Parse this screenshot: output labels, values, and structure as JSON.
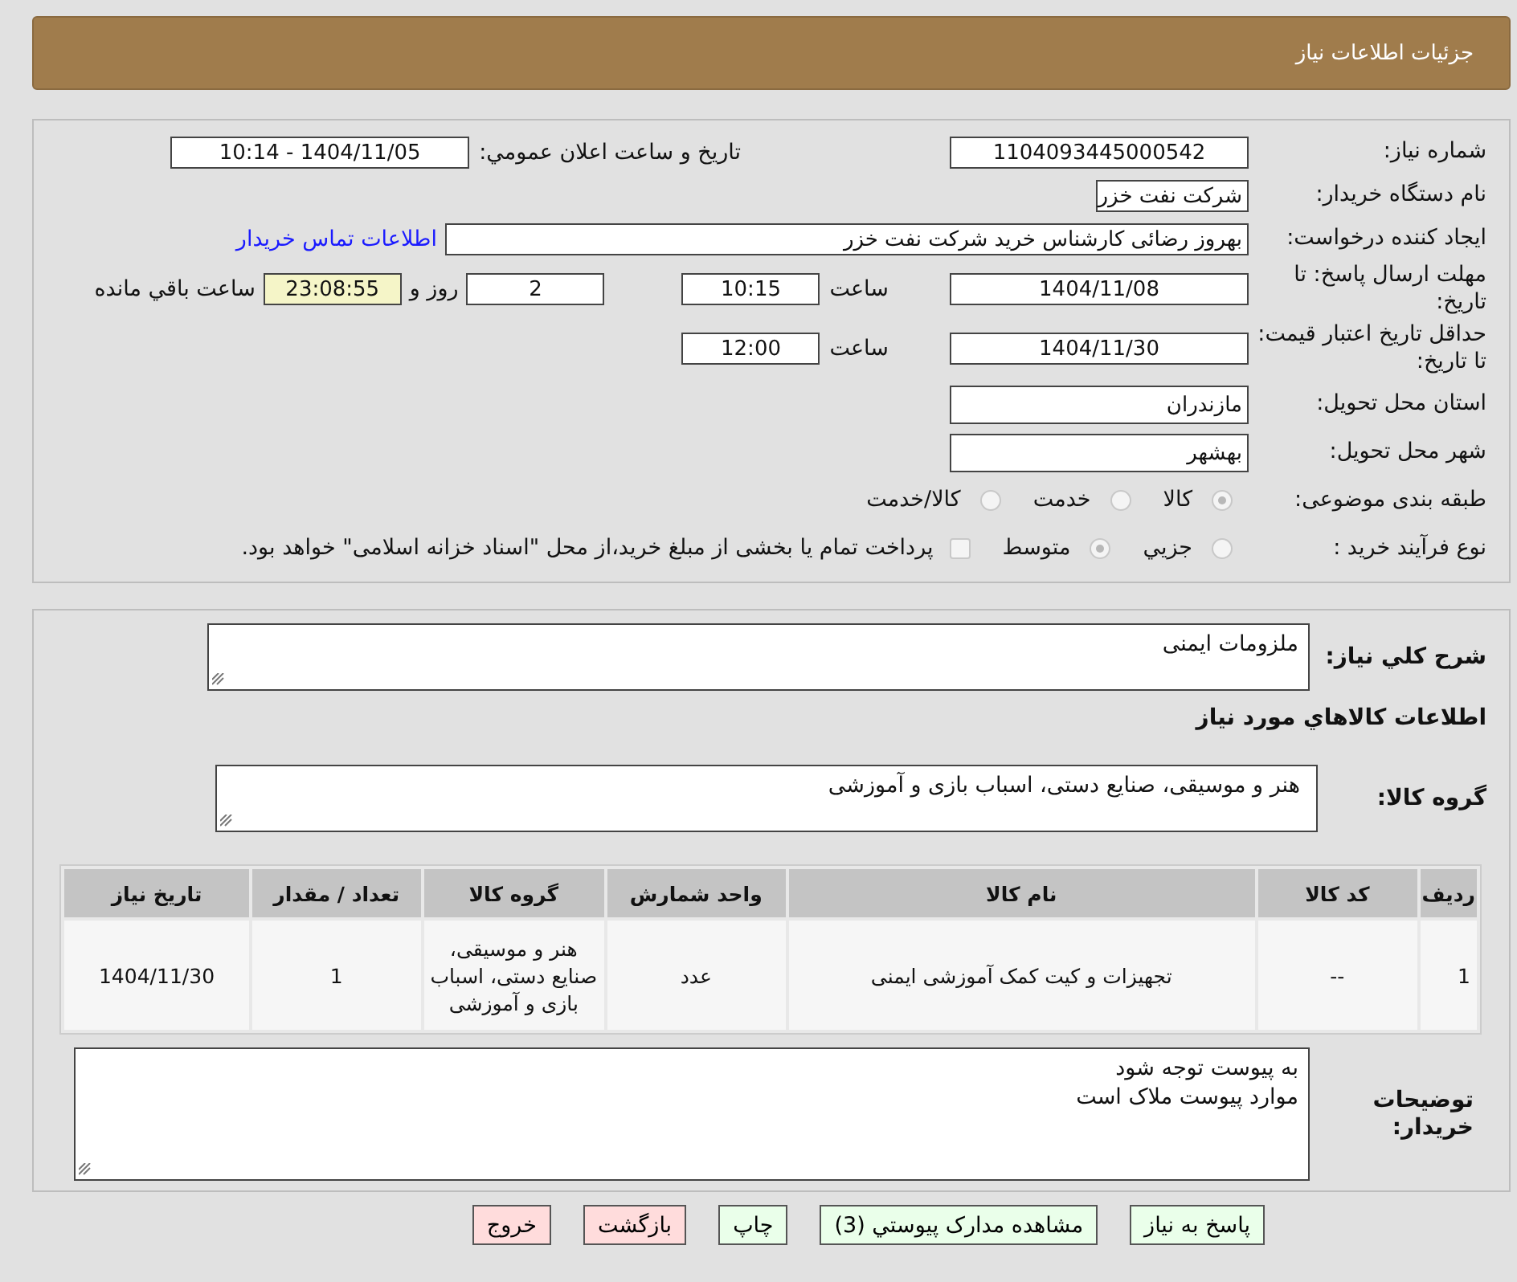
{
  "header": {
    "title": "جزئیات اطلاعات نیاز"
  },
  "details": {
    "need_number": {
      "label": "شماره نیاز:",
      "value": "1104093445000542"
    },
    "announce": {
      "label": "تاریخ و ساعت اعلان عمومي:",
      "value": "1404/11/05 - 10:14"
    },
    "buyer": {
      "label": "نام دستگاه خریدار:",
      "value": "شرکت نفت خزر"
    },
    "creator": {
      "label": "ایجاد کننده درخواست:",
      "value": "بهروز رضائی کارشناس خرید شرکت نفت خزر",
      "link": "اطلاعات تماس خریدار"
    },
    "deadline": {
      "label": "مهلت ارسال پاسخ: تا تاریخ:",
      "date": "1404/11/08",
      "time_label": "ساعت",
      "time": "10:15",
      "days": "2",
      "days_label": "روز و",
      "remaining": "23:08:55",
      "remaining_label": "ساعت باقي مانده"
    },
    "validity": {
      "label": "حداقل تاریخ اعتبار قیمت: تا تاریخ:",
      "date": "1404/11/30",
      "time_label": "ساعت",
      "time": "12:00"
    },
    "province": {
      "label": "استان محل تحویل:",
      "value": "مازندران"
    },
    "city": {
      "label": "شهر محل تحویل:",
      "value": "بهشهر"
    },
    "category": {
      "label": "طبقه بندی موضوعی:",
      "options": [
        {
          "label": "کالا",
          "selected": true
        },
        {
          "label": "خدمت",
          "selected": false
        },
        {
          "label": "کالا/خدمت",
          "selected": false
        }
      ]
    },
    "process": {
      "label": "نوع فرآیند خرید :",
      "options": [
        {
          "label": "جزيي",
          "selected": false
        },
        {
          "label": "متوسط",
          "selected": true
        }
      ],
      "treasury": {
        "checked": false,
        "label": "پرداخت تمام یا بخشی از مبلغ خرید،از محل \"اسناد خزانه اسلامی\" خواهد بود."
      }
    }
  },
  "description": {
    "label": "شرح كلي نياز:",
    "value": "ملزومات ایمنی"
  },
  "goods_heading": "اطلاعات كالاهاي مورد نياز",
  "goods_group": {
    "label": "گروه کالا:",
    "value": "هنر و موسیقی، صنایع دستی، اسباب بازی و آموزشی"
  },
  "table": {
    "columns": [
      "رديف",
      "کد کالا",
      "نام کالا",
      "واحد شمارش",
      "گروه کالا",
      "تعداد / مقدار",
      "تاریخ نیاز"
    ],
    "rows": [
      [
        "1",
        "--",
        "تجهیزات و کیت کمک آموزشی ایمنی",
        "عدد",
        "هنر و موسیقی، صنایع دستی، اسباب بازی و آموزشی",
        "1",
        "1404/11/30"
      ]
    ]
  },
  "buyer_notes": {
    "label": "توضیحات خریدار:",
    "lines": [
      "به پیوست توجه شود",
      "موارد پیوست ملاک است"
    ]
  },
  "buttons": [
    {
      "label": "پاسخ به نياز",
      "kind": "confirm"
    },
    {
      "label": "مشاهده مدارک پیوستي (3)",
      "kind": "confirm"
    },
    {
      "label": "چاپ",
      "kind": "confirm"
    },
    {
      "label": "بازگشت",
      "kind": "cancel"
    },
    {
      "label": "خروج",
      "kind": "cancel"
    }
  ]
}
